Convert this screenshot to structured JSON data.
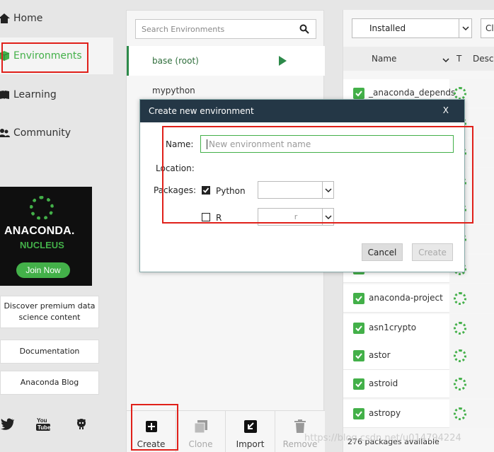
{
  "nav": {
    "home": "Home",
    "environments": "Environments",
    "learning": "Learning",
    "community": "Community"
  },
  "promo": {
    "brand": "ANACONDA.",
    "sub": "NUCLEUS",
    "button": "Join Now"
  },
  "links": {
    "discover": "Discover premium data science content",
    "documentation": "Documentation",
    "blog": "Anaconda Blog"
  },
  "environments": {
    "search_placeholder": "Search Environments",
    "items": [
      {
        "name": "base (root)",
        "active": true
      },
      {
        "name": "mypython",
        "active": false
      }
    ],
    "actions": {
      "create": "Create",
      "clone": "Clone",
      "import": "Import",
      "remove": "Remove"
    }
  },
  "packages": {
    "filter": "Installed",
    "channels_button": "Cl",
    "columns": {
      "name": "Name",
      "type": "T",
      "description": "Descr"
    },
    "rows": [
      "_anaconda_depends",
      "",
      "",
      "",
      "",
      "",
      "",
      "anaconda-project",
      "asn1crypto",
      "astor",
      "astroid",
      "astropy"
    ],
    "footer": "276 packages available"
  },
  "dialog": {
    "title": "Create new environment",
    "close": "X",
    "name_label": "Name:",
    "name_placeholder": "New environment name",
    "location_label": "Location:",
    "packages_label": "Packages:",
    "python_label": "Python",
    "python_checked": true,
    "python_version": "",
    "r_label": "R",
    "r_checked": false,
    "r_value": "r",
    "cancel": "Cancel",
    "create": "Create"
  },
  "watermark": "https://blog.csdn.net/u014794224",
  "colors": {
    "accent_green": "#43b049",
    "dialog_header": "#243746",
    "highlight_red": "#e0201a"
  }
}
